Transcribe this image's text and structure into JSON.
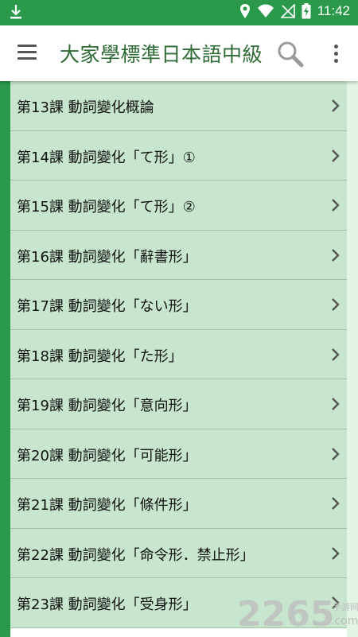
{
  "status_bar": {
    "time": "11:42",
    "icons": [
      "download-icon",
      "location-icon",
      "wifi-icon",
      "no-signal-icon",
      "battery-charging-icon"
    ]
  },
  "app_bar": {
    "title": "大家學標準日本語中級",
    "icons": [
      "menu-icon",
      "search-icon",
      "more-vert-icon"
    ]
  },
  "colors": {
    "accent": "#2a9a4a",
    "title": "#2e6b35",
    "item_bg": "#c8e6ce",
    "divider": "#9dc4a6"
  },
  "lessons": [
    {
      "label": "第13課 動詞變化概論"
    },
    {
      "label": "第14課 動詞變化「て形」①"
    },
    {
      "label": "第15課 動詞變化「て形」②"
    },
    {
      "label": "第16課 動詞變化「辭書形」"
    },
    {
      "label": "第17課 動詞變化「ない形」"
    },
    {
      "label": "第18課 動詞變化「た形」"
    },
    {
      "label": "第19課 動詞變化「意向形」"
    },
    {
      "label": "第20課 動詞變化「可能形」"
    },
    {
      "label": "第21課 動詞變化「條件形」"
    },
    {
      "label": "第22課 動詞變化「命令形．禁止形」"
    },
    {
      "label": "第23課 動詞變化「受身形」"
    }
  ],
  "watermark": {
    "number": "2265",
    "suffix": ".com",
    "tag": "手游网"
  }
}
